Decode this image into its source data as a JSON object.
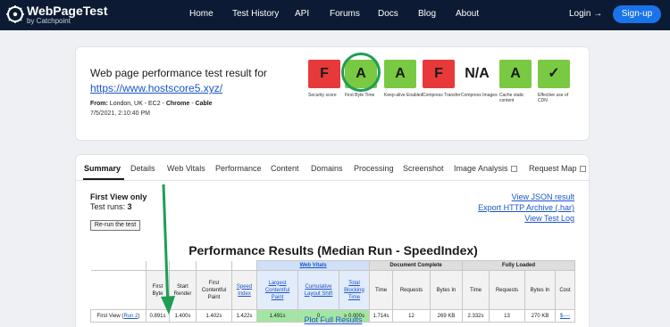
{
  "nav": {
    "brand": "WebPageTest",
    "brand_sub": "by Catchpoint",
    "links": [
      "Home",
      "Test History",
      "API",
      "Forums",
      "Docs",
      "Blog",
      "About"
    ],
    "login": "Login →",
    "signup": "Sign-up"
  },
  "summary": {
    "headline": "Web page performance test result for",
    "url": "https://www.hostscore5.xyz/",
    "from_label": "From:",
    "from_location": "London, UK - EC2 - ",
    "browser": "Chrome",
    "from_sep": " - ",
    "connection": "Cable",
    "date": "7/5/2021, 2:10:40 PM"
  },
  "grades": [
    {
      "grade": "F",
      "label": "Security score",
      "color": "#e8393a"
    },
    {
      "grade": "A",
      "label": "First Byte Time",
      "color": "#7ac943"
    },
    {
      "grade": "A",
      "label": "Keep-alive Enabled",
      "color": "#7ac943"
    },
    {
      "grade": "F",
      "label": "Compress Transfer",
      "color": "#e8393a"
    },
    {
      "grade": "N/A",
      "label": "Compress Images",
      "color": "#ffffff"
    },
    {
      "grade": "A",
      "label": "Cache static content",
      "color": "#7ac943"
    },
    {
      "grade": "✓",
      "label": "Effective use of CDN",
      "color": "#7ac943"
    }
  ],
  "tabs": [
    "Summary",
    "Details",
    "Web Vitals",
    "Performance",
    "Content",
    "Domains",
    "Processing",
    "Screenshot",
    "Image Analysis",
    "Request Map"
  ],
  "first_view": {
    "title": "First View only",
    "runs_label": "Test runs: ",
    "runs_value": "3",
    "rerun": "Re-run the test"
  },
  "links": {
    "json": "View JSON result",
    "har": "Export HTTP Archive (.har)",
    "log": "View Test Log"
  },
  "results": {
    "title": "Performance Results (Median Run - SpeedIndex)",
    "groups": {
      "web_vitals": "Web Vitals",
      "doc_complete": "Document Complete",
      "fully_loaded": "Fully Loaded"
    },
    "headers": [
      "First Byte",
      "Start Render",
      "First Contentful Paint",
      "Speed Index",
      "Largest Contentful Paint",
      "Cumulative Layout Shift",
      "Total Blocking Time",
      "Time",
      "Requests",
      "Bytes In",
      "Time",
      "Requests",
      "Bytes In",
      "Cost"
    ],
    "row_label": "First View (",
    "row_run": "Run 2",
    "row_label_end": ")",
    "values": [
      "0.891s",
      "1.400s",
      "1.402s",
      "1.422s",
      "1.491s",
      "0",
      "≥ 0.000s",
      "1.714s",
      "12",
      "269 KB",
      "2.332s",
      "13",
      "270 KB",
      "$----"
    ],
    "plot_link": "Plot Full Results"
  },
  "colors": {
    "nav_bg": "#0c1b33",
    "accent": "#1a73e8",
    "good": "#7ac943",
    "bad": "#e8393a",
    "annotation": "#1f9d55"
  }
}
